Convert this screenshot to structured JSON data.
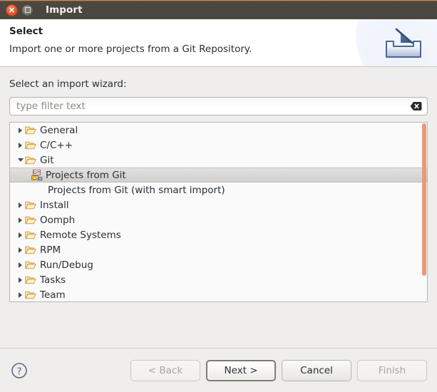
{
  "window": {
    "title": "Import",
    "close_icon": "close-icon",
    "maximize_icon": "maximize-icon"
  },
  "header": {
    "title": "Select",
    "description": "Import one or more projects from a Git Repository.",
    "icon": "import-wizard-icon"
  },
  "main": {
    "wizard_label": "Select an import wizard:",
    "filter": {
      "value": "",
      "placeholder": "type filter text",
      "clear_icon": "clear-icon"
    },
    "tree": {
      "items": [
        {
          "label": "General",
          "level": 0,
          "expanded": false,
          "icon": "folder-icon",
          "selected": false
        },
        {
          "label": "C/C++",
          "level": 0,
          "expanded": false,
          "icon": "folder-icon",
          "selected": false
        },
        {
          "label": "Git",
          "level": 0,
          "expanded": true,
          "icon": "folder-icon",
          "selected": false
        },
        {
          "label": "Projects from Git",
          "level": 1,
          "expanded": null,
          "icon": "git-project-icon",
          "selected": true
        },
        {
          "label": "Projects from Git (with smart import)",
          "level": 1,
          "expanded": null,
          "icon": "none",
          "selected": false
        },
        {
          "label": "Install",
          "level": 0,
          "expanded": false,
          "icon": "folder-icon",
          "selected": false
        },
        {
          "label": "Oomph",
          "level": 0,
          "expanded": false,
          "icon": "folder-icon",
          "selected": false
        },
        {
          "label": "Remote Systems",
          "level": 0,
          "expanded": false,
          "icon": "folder-icon",
          "selected": false
        },
        {
          "label": "RPM",
          "level": 0,
          "expanded": false,
          "icon": "folder-icon",
          "selected": false
        },
        {
          "label": "Run/Debug",
          "level": 0,
          "expanded": false,
          "icon": "folder-icon",
          "selected": false
        },
        {
          "label": "Tasks",
          "level": 0,
          "expanded": false,
          "icon": "folder-icon",
          "selected": false
        },
        {
          "label": "Team",
          "level": 0,
          "expanded": false,
          "icon": "folder-icon",
          "selected": false
        }
      ],
      "scrollbar_color": "#e79a77"
    }
  },
  "footer": {
    "help_icon": "help-icon",
    "buttons": [
      {
        "label": "< Back",
        "state": "disabled"
      },
      {
        "label": "Next >",
        "state": "default"
      },
      {
        "label": "Cancel",
        "state": "enabled"
      },
      {
        "label": "Finish",
        "state": "disabled"
      }
    ]
  },
  "colors": {
    "titlebar": "#4a4640",
    "titlebar_accent": "#e08a43",
    "body_bg": "#efeeec",
    "tree_bg": "#fafafa",
    "selection": "#d8d6d3",
    "scrollbar": "#e79a77"
  }
}
